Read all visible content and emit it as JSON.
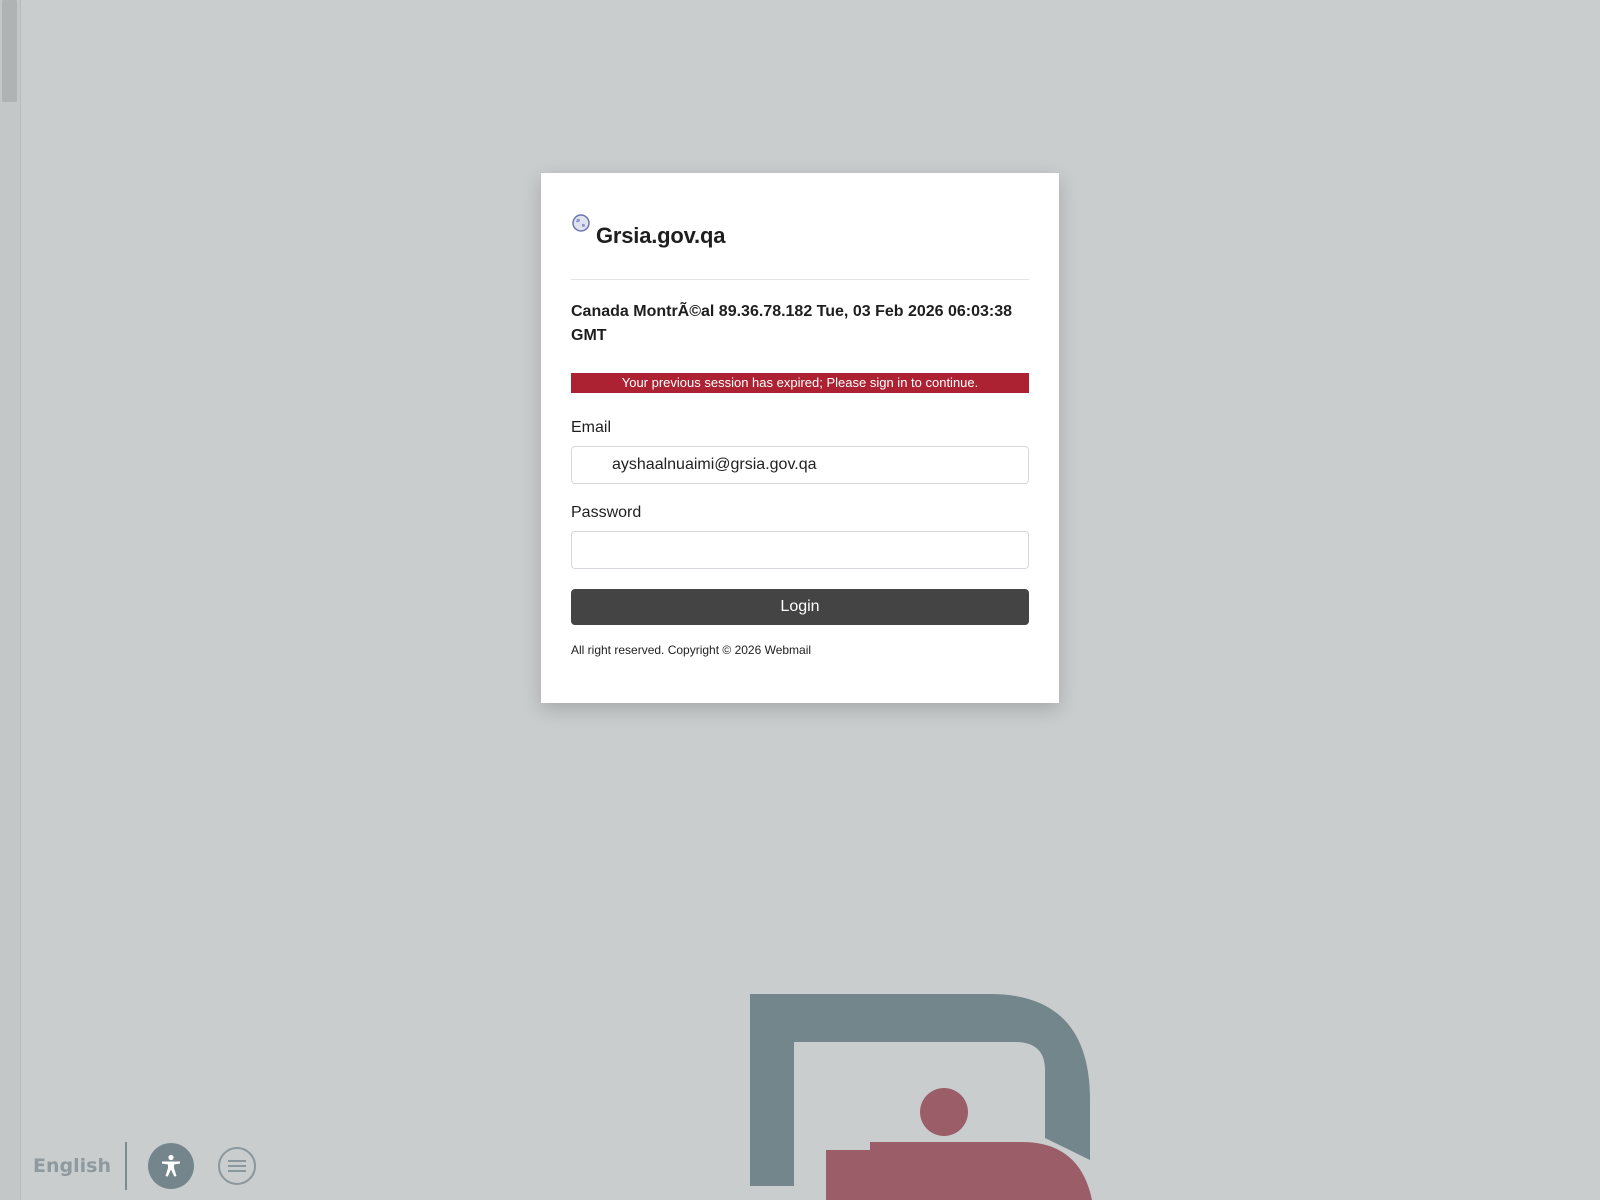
{
  "brand": {
    "title": "Grsia.gov.qa",
    "icon": "globe-icon"
  },
  "location_info": "Canada MontrÃ©al 89.36.78.182 Tue, 03 Feb 2026 06:03:38 GMT",
  "alert": {
    "message": "Your previous session has expired; Please sign in to continue.",
    "color": "#ac2232"
  },
  "form": {
    "email_label": "Email",
    "email_value": "ayshaalnuaimi@grsia.gov.qa",
    "password_label": "Password",
    "password_value": "",
    "login_label": "Login",
    "button_color": "#444444"
  },
  "footer": {
    "copyright": "All right reserved. Copyright © 2026 Webmail"
  },
  "toolbar": {
    "language": "English",
    "accessibility_icon": "accessibility-icon",
    "menu_icon": "menu-icon"
  },
  "background": {
    "color": "#c9cdce",
    "logo": "watermark-logo",
    "logo_colors": [
      "#73868c",
      "#9b5e69"
    ]
  }
}
